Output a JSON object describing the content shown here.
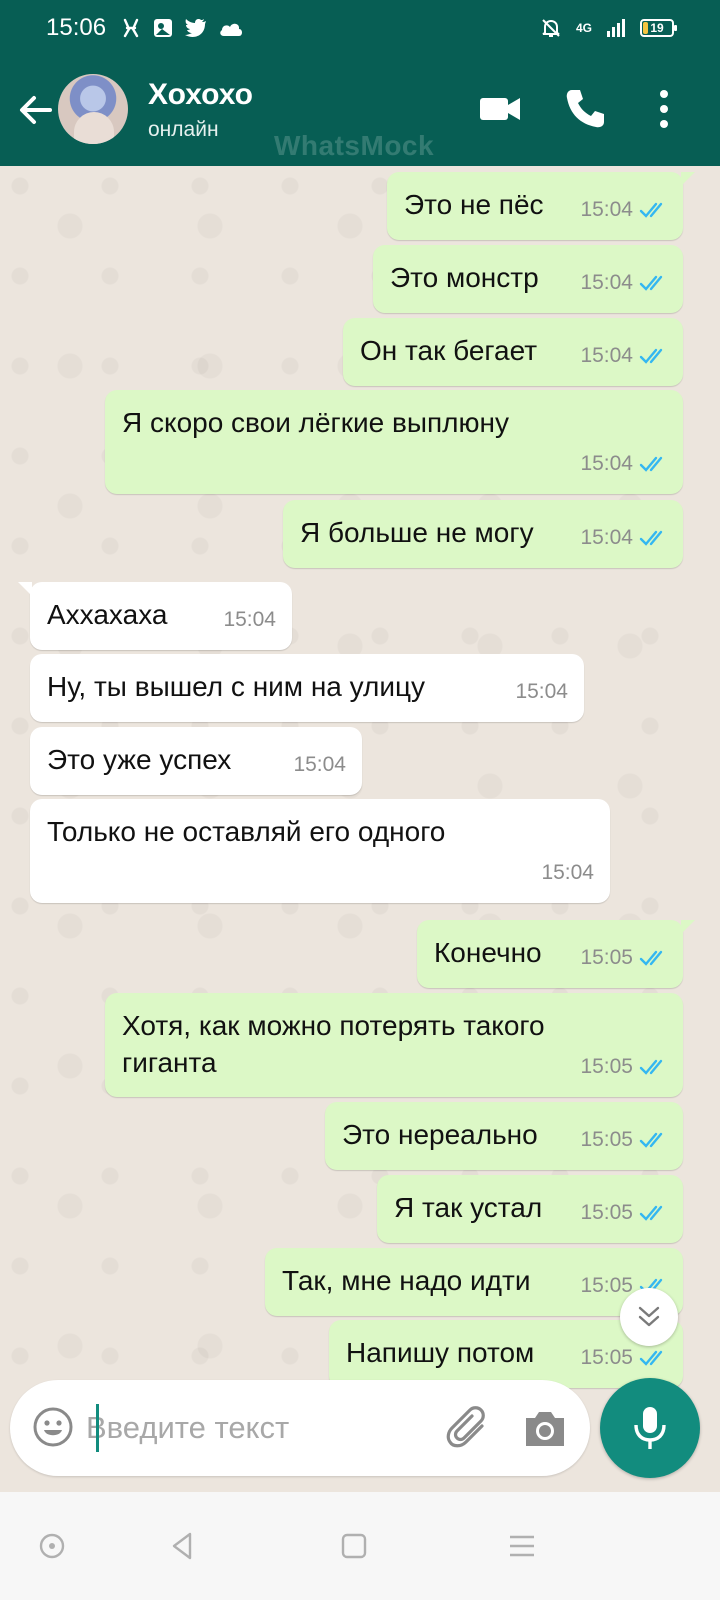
{
  "status_bar": {
    "time": "15:06",
    "network": "4G",
    "battery": "19"
  },
  "header": {
    "contact_name": "Хохохо",
    "contact_status": "онлайн",
    "watermark": "WhatsMock"
  },
  "messages": [
    {
      "dir": "out",
      "text": "Это не пёс",
      "time": "15:04"
    },
    {
      "dir": "out",
      "text": "Это монстр",
      "time": "15:04"
    },
    {
      "dir": "out",
      "text": "Он так бегает",
      "time": "15:04"
    },
    {
      "dir": "out",
      "text": "Я скоро свои лёгкие выплюну",
      "time": "15:04"
    },
    {
      "dir": "out",
      "text": "Я больше не могу",
      "time": "15:04"
    },
    {
      "dir": "in",
      "text": "Аххахаха",
      "time": "15:04"
    },
    {
      "dir": "in",
      "text": "Ну, ты вышел с ним на улицу",
      "time": "15:04"
    },
    {
      "dir": "in",
      "text": "Это уже успех",
      "time": "15:04"
    },
    {
      "dir": "in",
      "text": "Только не оставляй его одного",
      "time": "15:04"
    },
    {
      "dir": "out",
      "text": "Конечно",
      "time": "15:05"
    },
    {
      "dir": "out",
      "text": "Хотя, как можно потерять такого гиганта",
      "time": "15:05"
    },
    {
      "dir": "out",
      "text": "Это нереально",
      "time": "15:05"
    },
    {
      "dir": "out",
      "text": "Я так устал",
      "time": "15:05"
    },
    {
      "dir": "out",
      "text": "Так, мне надо идти",
      "time": "15:05"
    },
    {
      "dir": "out",
      "text": "Напишу потом",
      "time": "15:05"
    }
  ],
  "composer": {
    "placeholder": "Введите текст"
  },
  "colors": {
    "header": "#075e54",
    "outgoing_bubble": "#dcf8c6",
    "incoming_bubble": "#ffffff",
    "read_ticks": "#34b7f1",
    "mic_button": "#128c7e"
  },
  "icons": {
    "back": "arrow-left-icon",
    "video": "video-camera-icon",
    "call": "phone-icon",
    "menu": "more-vertical-icon",
    "emoji": "smiley-icon",
    "attach": "paperclip-icon",
    "camera": "camera-icon",
    "mic": "microphone-icon",
    "scroll": "double-chevron-down-icon"
  }
}
